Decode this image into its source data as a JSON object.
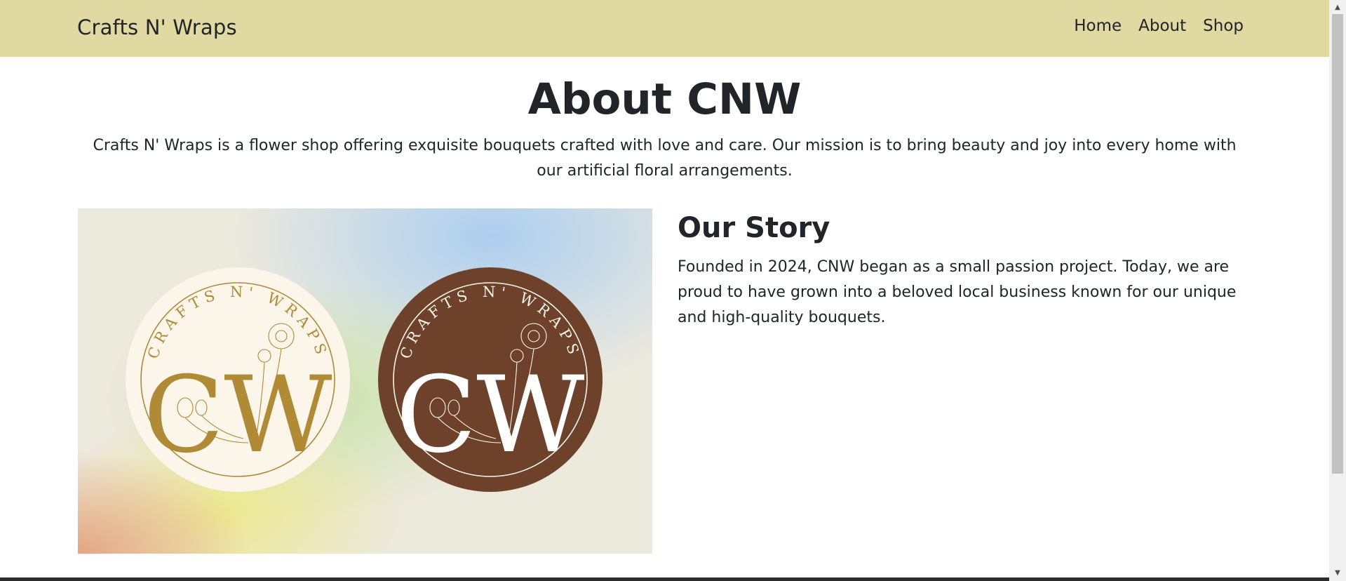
{
  "navbar": {
    "brand": "Crafts N' Wraps",
    "links": [
      "Home",
      "About",
      "Shop"
    ]
  },
  "main": {
    "title": "About CNW",
    "intro": "Crafts N' Wraps is a flower shop offering exquisite bouquets crafted with love and care. Our mission is to bring beauty and joy into every home with our artificial floral arrangements.",
    "story": {
      "heading": "Our Story",
      "text": "Founded in 2024, CNW began as a small passion project. Today, we are proud to have grown into a beloved local business known for our unique and high-quality bouquets."
    },
    "hero_logo": {
      "ring_text": "CRAFTS N' WRAPS",
      "monogram": "CW"
    }
  },
  "colors": {
    "navbar": "#e0d9a2",
    "logo_gold": "#b08a35",
    "logo_brown": "#6e412a",
    "logo_cream": "#fbf5ea"
  },
  "icons": [
    "scroll-up-arrow-icon",
    "scroll-down-arrow-icon",
    "flower-icon"
  ]
}
